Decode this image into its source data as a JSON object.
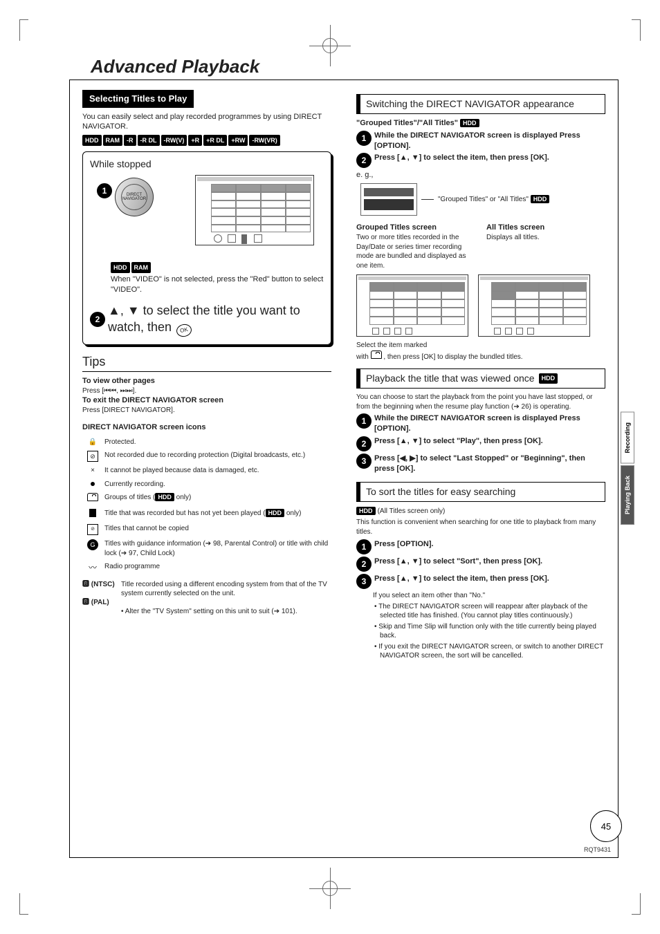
{
  "page": {
    "title": "Advanced Playback",
    "number": "45",
    "code": "RQT9431"
  },
  "side_tabs": {
    "recording": "Recording",
    "playing_back": "Playing Back"
  },
  "left": {
    "section_header": "Selecting Titles to Play",
    "intro": "You can easily select and play recorded programmes by using DIRECT NAVIGATOR.",
    "discs": [
      "HDD",
      "RAM",
      "-R",
      "-R DL",
      "-RW(V)",
      "+R",
      "+R DL",
      "+RW",
      "-RW(VR)"
    ],
    "while_stopped": "While stopped",
    "step1_btn": "DIRECT NAVIGATOR",
    "hdd_ram_discs": [
      "HDD",
      "RAM"
    ],
    "hdd_ram_note": "When \"VIDEO\" is not selected, press the \"Red\" button to select \"VIDEO\".",
    "step2": "▲, ▼ to select the title you want to watch, then ",
    "step2_ok": "OK",
    "tips_heading": "Tips",
    "tips": {
      "other_pages_h": "To view other pages",
      "other_pages_t": "Press [⏮⏮, ⏭⏭].",
      "exit_h": "To exit the DIRECT NAVIGATOR screen",
      "exit_t": "Press [DIRECT NAVIGATOR]."
    },
    "icons_heading": "DIRECT NAVIGATOR screen icons",
    "icons": {
      "protected": "Protected.",
      "not_recorded": "Not recorded due to recording protection (Digital broadcasts, etc.)",
      "damaged": "It cannot be played because data is damaged, etc.",
      "recording": "Currently recording.",
      "groups_pre": "Groups of titles (",
      "groups_post": " only)",
      "groups_disc": "HDD",
      "not_played_pre": "Title that was recorded but has not yet been played (",
      "not_played_post": " only)",
      "not_played_disc": "HDD",
      "no_copy": "Titles that cannot be copied",
      "guidance": "Titles with guidance information (➔ 98, Parental Control) or title with child lock (➔ 97, Child Lock)",
      "radio": "Radio programme"
    },
    "ntsc_tag": "🅱 (NTSC)",
    "pal_tag": "🅱 (PAL)",
    "system_text": "Title recorded using a different encoding system from that of the TV system currently selected on the unit.",
    "system_bullet": "• Alter the \"TV System\" setting on this unit to suit (➔ 101)."
  },
  "right": {
    "switching_header": "Switching the DIRECT NAVIGATOR appearance",
    "grouped_all_label": "\"Grouped Titles\"/\"All Titles\"",
    "grouped_all_disc": "HDD",
    "sw_step1": "While the DIRECT NAVIGATOR screen is displayed Press [OPTION].",
    "sw_step2": "Press [▲, ▼] to select the item, then press [OK].",
    "eg": "e. g.,",
    "callout_pre": "\"Grouped Titles\" or \"All Titles\" ",
    "callout_disc": "HDD",
    "grouped_h": "Grouped Titles screen",
    "grouped_t": "Two or more titles recorded in the Day/Date or series timer recording mode are bundled and displayed as one item.",
    "all_h": "All Titles screen",
    "all_t": "Displays all titles.",
    "select_marked_1": "Select the item marked",
    "select_marked_2": "with ",
    "select_marked_3": " , then press [OK] to display the bundled titles.",
    "playback_header": "Playback the title that was viewed once",
    "playback_disc": "HDD",
    "playback_intro": "You can choose to start the playback from the point you have last stopped, or from the beginning when the resume play function (➔ 26) is operating.",
    "pb_step1": "While the DIRECT NAVIGATOR screen is displayed Press [OPTION].",
    "pb_step2": "Press [▲, ▼] to select \"Play\", then press [OK].",
    "pb_step3": "Press [◀, ▶] to select \"Last Stopped\" or \"Beginning\", then press [OK].",
    "sort_header": "To sort the titles for easy searching",
    "sort_disc": "HDD",
    "sort_sub": "(All Titles screen only)",
    "sort_intro": "This function is convenient when searching for one title to playback from many titles.",
    "sort_step1": "Press [OPTION].",
    "sort_step2": "Press [▲, ▼] to select \"Sort\", then press [OK].",
    "sort_step3": "Press [▲, ▼] to select the item, then press [OK].",
    "sort_note_intro": "If you select an item other than \"No.\"",
    "sort_b1": "The DIRECT NAVIGATOR screen will reappear after playback of the selected title has finished. (You cannot play titles continuously.)",
    "sort_b2": "Skip and Time Slip will function only with the title currently being played back.",
    "sort_b3": "If you exit the DIRECT NAVIGATOR screen, or switch to another DIRECT NAVIGATOR screen, the sort will be cancelled."
  }
}
